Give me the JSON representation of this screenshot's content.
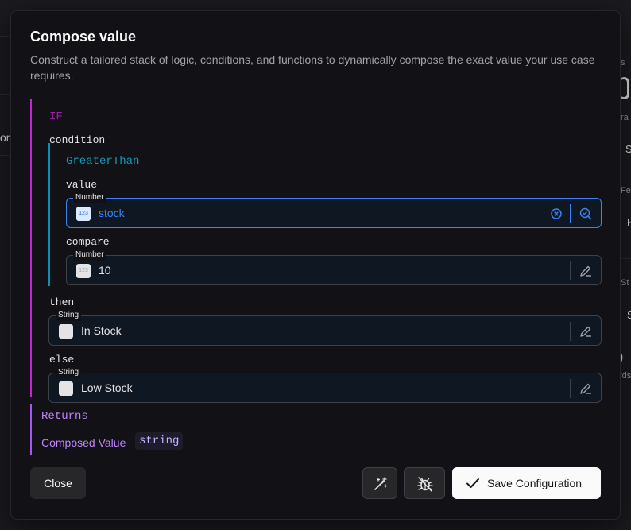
{
  "background": {
    "fragments": [
      "s",
      "ra",
      "S",
      "Fe",
      "F",
      "St",
      "S",
      ")",
      "rds",
      "ora"
    ]
  },
  "modal": {
    "title": "Compose value",
    "description": "Construct a tailored stack of logic, conditions, and functions to dynamically compose the exact value your use case requires.",
    "if_keyword": "IF",
    "condition_label": "condition",
    "function_keyword": "GreaterThan",
    "value_label": "value",
    "value_field": {
      "type_tag": "Number",
      "type_icon": "123",
      "value": "stock"
    },
    "compare_label": "compare",
    "compare_field": {
      "type_tag": "Number",
      "type_icon": "123",
      "value": "10"
    },
    "then_label": "then",
    "then_field": {
      "type_tag": "String",
      "value": "In Stock"
    },
    "else_label": "else",
    "else_field": {
      "type_tag": "String",
      "value": "Low Stock"
    },
    "returns_keyword": "Returns",
    "composed_label": "Composed Value",
    "composed_type": "string"
  },
  "footer": {
    "close_label": "Close",
    "magic_icon": "wand-sparkles-icon",
    "debug_icon": "bug-icon",
    "save_label": "Save Configuration"
  },
  "colors": {
    "if_border": "#c026d3",
    "function_border": "#0891b2",
    "returns_border": "#a855f7",
    "active_field": "#3b82f6"
  }
}
